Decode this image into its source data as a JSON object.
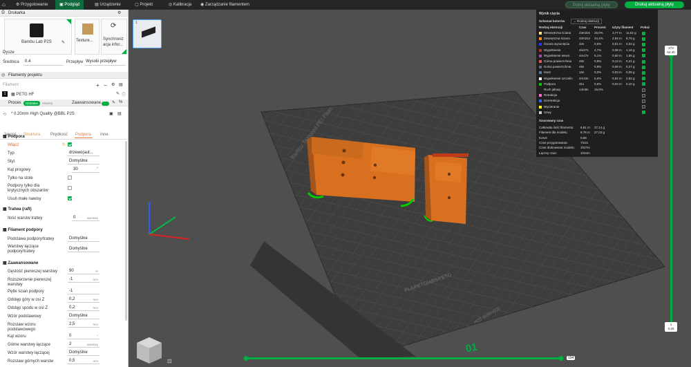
{
  "topbar": {
    "tabs": [
      "Przygotowanie",
      "Podgląd",
      "Urządzenie",
      "Projekt",
      "Kalibracja",
      "Zarządzanie filamentem"
    ],
    "active_tab": 1,
    "slice_plate": "Potnij aktualną płytę",
    "print_plate": "Drukuj aktualną płytę"
  },
  "left": {
    "printer_section": "Drukarka",
    "printer_name": "Bambu Lab P2S",
    "plate_label": "Texture...",
    "sync_label_1": "Synchroniz",
    "sync_label_2": "acja infor...",
    "nozzle_label": "Dysze",
    "diameter_label": "Średnica",
    "diameter_value": "0.4",
    "flow_label": "Przepływ",
    "flow_value": "Wysoki przepływ",
    "filaments_section": "Filamenty projektu",
    "filament_header": "Filament",
    "filament_num": "1",
    "filament_name": "PETG HF",
    "process_section": "Proces",
    "global_tag": "Globalne",
    "object_tag": "Obiekty",
    "advanced_toggle": "Zaawansowane",
    "profile": "* 0.20mm High Quality @BBL P2S",
    "tabs": [
      "Jakość",
      "Struktura",
      "Prędkość",
      "Podpora",
      "Inne"
    ],
    "active_tab": 3,
    "support_header": "Podpora",
    "enable_label": "Włącz",
    "type_label": "Typ",
    "type_value": "drzewo(aut...",
    "style_label": "Styl",
    "style_value": "Domyślne",
    "angle_label": "Kąt progowy",
    "angle_value": "30",
    "angle_unit": "°",
    "onplate_label": "Tylko na stole",
    "critical_label_1": "Podpory tylko dla",
    "critical_label_2": "krytycznych obszarów",
    "small_label": "Usuń małe nawisy",
    "raft_header": "Tratwa (raft)",
    "raft_layers_label": "Ilość warstw tratwy",
    "raft_layers_value": "0",
    "layers_unit": "warstwy",
    "filament_sup_header": "Filament podpory",
    "base_label": "Podstawa podpory/tratwy",
    "base_value": "Domyślne",
    "interface_label_1": "Warstwy łączące",
    "interface_label_2": "podpory/tratwy",
    "interface_value": "Domyślne",
    "advanced_header": "Zaawansowane",
    "adv_rows": [
      {
        "label": "Gęstość pierwszej warstwy",
        "value": "90",
        "unit": "%"
      },
      {
        "label": "Rozszerzenie pierwszej",
        "label2": "warstwy",
        "value": "-1",
        "unit": "mm"
      },
      {
        "label": "Pętle ścian podpory",
        "value": "-1",
        "unit": ""
      },
      {
        "label": "Odstęp góry w osi Z",
        "value": "0,2",
        "unit": "mm"
      },
      {
        "label": "Odstęp spodu w osi Z",
        "value": "0,2",
        "unit": "mm"
      },
      {
        "label": "Wzór podstawowy",
        "value": "Domyślne",
        "unit": ""
      },
      {
        "label": "Rozstaw wzoru",
        "label2": "podstawowego",
        "value": "2,5",
        "unit": "mm"
      },
      {
        "label": "Kąt wzoru",
        "value": "0",
        "unit": "°"
      },
      {
        "label": "Górne warstwy łączące",
        "value": "2",
        "unit": "warstwy"
      },
      {
        "label": "Wzór warstwy łączącej",
        "value": "Domyślne",
        "unit": ""
      },
      {
        "label": "Rozstaw górnych warstw",
        "value": "0,5",
        "unit": "mm"
      }
    ]
  },
  "viewport": {
    "plate_num": "1",
    "bed_brand": "Bambu Textured PEI Plate",
    "bed_materials": "PLA/PETG/ABS/PETG",
    "bed_label2": "HOT SURFACE",
    "bed_number": "01",
    "slider_top_1": "273",
    "slider_top_2": "54.40",
    "slider_bottom_1": "1",
    "slider_bottom_2": "0.20",
    "hslider_value": "104"
  },
  "stats": {
    "title": "Wynik cięcia",
    "scheme_label": "Schemat kolorów",
    "scheme_value": "Rodzaj ekstruzji",
    "col_headers": [
      "Rodzaj ekstruzji",
      "Czas",
      "Procent",
      "Użyty filament",
      "Pokaż"
    ],
    "rows": [
      {
        "name": "Wewnętrzna ściana",
        "time": "23m32s",
        "pct": "25,0%",
        "len": "3,77 m",
        "wt": "11,62 g",
        "color": "#ffe680",
        "on": true
      },
      {
        "name": "Zewnętrzna ściana",
        "time": "32m21s",
        "pct": "34,4%",
        "len": "2,84 m",
        "wt": "8,75 g",
        "color": "#ff8c1a",
        "on": true
      },
      {
        "name": "Ściana wysunięcia",
        "time": "32s",
        "pct": "0,6%",
        "len": "0,01 m",
        "wt": "0,04 g",
        "color": "#3333ff",
        "on": true
      },
      {
        "name": "Wypełnienie",
        "time": "4m27s",
        "pct": "4,7%",
        "len": "0,38 m",
        "wt": "1,18 g",
        "color": "#b33333",
        "on": true
      },
      {
        "name": "Wypełnienie wewn.",
        "time": "4m47s",
        "pct": "5,1%",
        "len": "0,60 m",
        "wt": "1,85 g",
        "color": "#a34ca3",
        "on": true
      },
      {
        "name": "Górna powierzchnia",
        "time": "48s",
        "pct": "0,9%",
        "len": "0,13 m",
        "wt": "0,41 g",
        "color": "#e65c5c",
        "on": true
      },
      {
        "name": "Dolna powierzchnia",
        "time": "49s",
        "pct": "0,9%",
        "len": "0,09 m",
        "wt": "0,27 g",
        "color": "#66668c",
        "on": true
      },
      {
        "name": "Most",
        "time": "16s",
        "pct": "0,3%",
        "len": "0,03 m",
        "wt": "0,09 g",
        "color": "#4d8099",
        "on": true
      },
      {
        "name": "Wypełnienie szczelin",
        "time": "4m43s",
        "pct": "5,0%",
        "len": "0,92 m",
        "wt": "2,82 g",
        "color": "#ffffff",
        "on": true
      },
      {
        "name": "Podpora",
        "time": "31s",
        "pct": "0,6%",
        "len": "0,03 m",
        "wt": "0,10 g",
        "color": "#00cc00",
        "on": true
      },
      {
        "name": "Ruch jałowy",
        "time": "14m8s",
        "pct": "15,0%",
        "len": "",
        "wt": "",
        "color": "",
        "on": false
      },
      {
        "name": "Retrakcja",
        "time": "",
        "pct": "",
        "len": "",
        "wt": "",
        "color": "#ff66cc",
        "on": false
      },
      {
        "name": "Deretrakcja",
        "time": "",
        "pct": "",
        "len": "",
        "wt": "",
        "color": "#3366ff",
        "on": false
      },
      {
        "name": "Wycieranie",
        "time": "",
        "pct": "",
        "len": "",
        "wt": "",
        "color": "#ffff00",
        "on": false
      },
      {
        "name": "Szwy",
        "time": "",
        "pct": "",
        "len": "",
        "wt": "",
        "color": "#cccccc",
        "on": true
      }
    ],
    "est_title": "Szacowany czas",
    "est_rows": [
      {
        "label": "Całkowita ilość filamentu:",
        "v1": "8,81 m",
        "v2": "27,14 g"
      },
      {
        "label": "Filament dla modelu:",
        "v1": "8,78 m",
        "v2": "27,03 g"
      },
      {
        "label": "Koszt:",
        "v1": "0,68",
        "v2": ""
      },
      {
        "label": "Czas przygotowania:",
        "v1": "7m2s",
        "v2": ""
      },
      {
        "label": "Czas drukowania modelu:",
        "v1": "1h27m",
        "v2": ""
      },
      {
        "label": "Łączny czas:",
        "v1": "1h34m",
        "v2": ""
      }
    ]
  }
}
